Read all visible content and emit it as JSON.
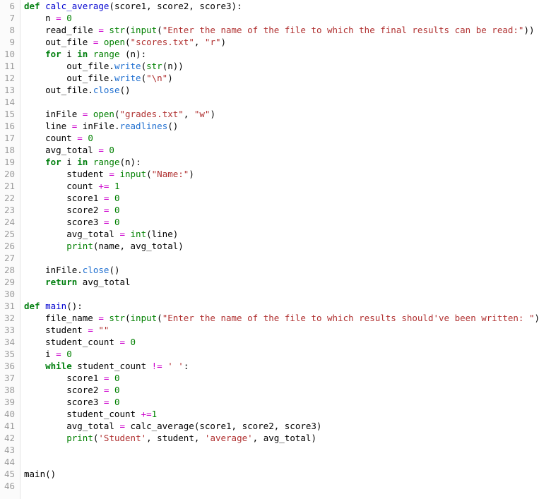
{
  "editor": {
    "language": "Python",
    "first_line_number": 6,
    "last_line_number": 46,
    "colors": {
      "background": "#ffffff",
      "gutter_background": "#fbfbfb",
      "gutter_border": "#e4e4e4",
      "line_number": "#9b9b9b",
      "plain_text": "#000000",
      "keyword": "#007f0e",
      "builtin": "#008000",
      "function_def": "#0000d0",
      "method": "#1f6fd0",
      "string": "#b03030",
      "number": "#008000",
      "operator": "#cc00cc"
    }
  },
  "lines": [
    {
      "n": "6",
      "text": "def calc_average(score1, score2, score3):",
      "tokens": [
        {
          "t": "def",
          "c": "kw"
        },
        {
          "t": " ",
          "c": "pl"
        },
        {
          "t": "calc_average",
          "c": "fn"
        },
        {
          "t": "(score1, score2, score3):",
          "c": "pl"
        }
      ]
    },
    {
      "n": "7",
      "text": "    n = 0",
      "tokens": [
        {
          "t": "    n ",
          "c": "pl"
        },
        {
          "t": "=",
          "c": "op"
        },
        {
          "t": " ",
          "c": "pl"
        },
        {
          "t": "0",
          "c": "num"
        }
      ]
    },
    {
      "n": "8",
      "text": "    read_file = str(input(\"Enter the name of the file to which the final results can be read:\"))",
      "tokens": [
        {
          "t": "    read_file ",
          "c": "pl"
        },
        {
          "t": "=",
          "c": "op"
        },
        {
          "t": " ",
          "c": "pl"
        },
        {
          "t": "str",
          "c": "bi"
        },
        {
          "t": "(",
          "c": "pl"
        },
        {
          "t": "input",
          "c": "bi"
        },
        {
          "t": "(",
          "c": "pl"
        },
        {
          "t": "\"Enter the name of the file to which the final results can be read:\"",
          "c": "str"
        },
        {
          "t": "))",
          "c": "pl"
        }
      ]
    },
    {
      "n": "9",
      "text": "    out_file = open(\"scores.txt\", \"r\")",
      "tokens": [
        {
          "t": "    out_file ",
          "c": "pl"
        },
        {
          "t": "=",
          "c": "op"
        },
        {
          "t": " ",
          "c": "pl"
        },
        {
          "t": "open",
          "c": "bi"
        },
        {
          "t": "(",
          "c": "pl"
        },
        {
          "t": "\"scores.txt\"",
          "c": "str"
        },
        {
          "t": ", ",
          "c": "pl"
        },
        {
          "t": "\"r\"",
          "c": "str"
        },
        {
          "t": ")",
          "c": "pl"
        }
      ]
    },
    {
      "n": "10",
      "text": "    for i in range (n):",
      "tokens": [
        {
          "t": "    ",
          "c": "pl"
        },
        {
          "t": "for",
          "c": "kw"
        },
        {
          "t": " i ",
          "c": "pl"
        },
        {
          "t": "in",
          "c": "kw"
        },
        {
          "t": " ",
          "c": "pl"
        },
        {
          "t": "range",
          "c": "bi"
        },
        {
          "t": " (n):",
          "c": "pl"
        }
      ]
    },
    {
      "n": "11",
      "text": "        out_file.write(str(n))",
      "tokens": [
        {
          "t": "        out_file.",
          "c": "pl"
        },
        {
          "t": "write",
          "c": "mth"
        },
        {
          "t": "(",
          "c": "pl"
        },
        {
          "t": "str",
          "c": "bi"
        },
        {
          "t": "(n))",
          "c": "pl"
        }
      ]
    },
    {
      "n": "12",
      "text": "        out_file.write(\"\\n\")",
      "tokens": [
        {
          "t": "        out_file.",
          "c": "pl"
        },
        {
          "t": "write",
          "c": "mth"
        },
        {
          "t": "(",
          "c": "pl"
        },
        {
          "t": "\"\\n\"",
          "c": "str"
        },
        {
          "t": ")",
          "c": "pl"
        }
      ]
    },
    {
      "n": "13",
      "text": "    out_file.close()",
      "tokens": [
        {
          "t": "    out_file.",
          "c": "pl"
        },
        {
          "t": "close",
          "c": "mth"
        },
        {
          "t": "()",
          "c": "pl"
        }
      ]
    },
    {
      "n": "14",
      "text": "",
      "tokens": []
    },
    {
      "n": "15",
      "text": "    inFile = open(\"grades.txt\", \"w\")",
      "tokens": [
        {
          "t": "    inFile ",
          "c": "pl"
        },
        {
          "t": "=",
          "c": "op"
        },
        {
          "t": " ",
          "c": "pl"
        },
        {
          "t": "open",
          "c": "bi"
        },
        {
          "t": "(",
          "c": "pl"
        },
        {
          "t": "\"grades.txt\"",
          "c": "str"
        },
        {
          "t": ", ",
          "c": "pl"
        },
        {
          "t": "\"w\"",
          "c": "str"
        },
        {
          "t": ")",
          "c": "pl"
        }
      ]
    },
    {
      "n": "16",
      "text": "    line = inFile.readlines()",
      "tokens": [
        {
          "t": "    line ",
          "c": "pl"
        },
        {
          "t": "=",
          "c": "op"
        },
        {
          "t": " inFile.",
          "c": "pl"
        },
        {
          "t": "readlines",
          "c": "mth"
        },
        {
          "t": "()",
          "c": "pl"
        }
      ]
    },
    {
      "n": "17",
      "text": "    count = 0",
      "tokens": [
        {
          "t": "    count ",
          "c": "pl"
        },
        {
          "t": "=",
          "c": "op"
        },
        {
          "t": " ",
          "c": "pl"
        },
        {
          "t": "0",
          "c": "num"
        }
      ]
    },
    {
      "n": "18",
      "text": "    avg_total = 0",
      "tokens": [
        {
          "t": "    avg_total ",
          "c": "pl"
        },
        {
          "t": "=",
          "c": "op"
        },
        {
          "t": " ",
          "c": "pl"
        },
        {
          "t": "0",
          "c": "num"
        }
      ]
    },
    {
      "n": "19",
      "text": "    for i in range(n):",
      "tokens": [
        {
          "t": "    ",
          "c": "pl"
        },
        {
          "t": "for",
          "c": "kw"
        },
        {
          "t": " i ",
          "c": "pl"
        },
        {
          "t": "in",
          "c": "kw"
        },
        {
          "t": " ",
          "c": "pl"
        },
        {
          "t": "range",
          "c": "bi"
        },
        {
          "t": "(n):",
          "c": "pl"
        }
      ]
    },
    {
      "n": "20",
      "text": "        student = input(\"Name:\")",
      "tokens": [
        {
          "t": "        student ",
          "c": "pl"
        },
        {
          "t": "=",
          "c": "op"
        },
        {
          "t": " ",
          "c": "pl"
        },
        {
          "t": "input",
          "c": "bi"
        },
        {
          "t": "(",
          "c": "pl"
        },
        {
          "t": "\"Name:\"",
          "c": "str"
        },
        {
          "t": ")",
          "c": "pl"
        }
      ]
    },
    {
      "n": "21",
      "text": "        count += 1",
      "tokens": [
        {
          "t": "        count ",
          "c": "pl"
        },
        {
          "t": "+=",
          "c": "op"
        },
        {
          "t": " ",
          "c": "pl"
        },
        {
          "t": "1",
          "c": "num"
        }
      ]
    },
    {
      "n": "22",
      "text": "        score1 = 0",
      "tokens": [
        {
          "t": "        score1 ",
          "c": "pl"
        },
        {
          "t": "=",
          "c": "op"
        },
        {
          "t": " ",
          "c": "pl"
        },
        {
          "t": "0",
          "c": "num"
        }
      ]
    },
    {
      "n": "23",
      "text": "        score2 = 0",
      "tokens": [
        {
          "t": "        score2 ",
          "c": "pl"
        },
        {
          "t": "=",
          "c": "op"
        },
        {
          "t": " ",
          "c": "pl"
        },
        {
          "t": "0",
          "c": "num"
        }
      ]
    },
    {
      "n": "24",
      "text": "        score3 = 0",
      "tokens": [
        {
          "t": "        score3 ",
          "c": "pl"
        },
        {
          "t": "=",
          "c": "op"
        },
        {
          "t": " ",
          "c": "pl"
        },
        {
          "t": "0",
          "c": "num"
        }
      ]
    },
    {
      "n": "25",
      "text": "        avg_total = int(line)",
      "tokens": [
        {
          "t": "        avg_total ",
          "c": "pl"
        },
        {
          "t": "=",
          "c": "op"
        },
        {
          "t": " ",
          "c": "pl"
        },
        {
          "t": "int",
          "c": "bi"
        },
        {
          "t": "(line)",
          "c": "pl"
        }
      ]
    },
    {
      "n": "26",
      "text": "        print(name, avg_total)",
      "tokens": [
        {
          "t": "        ",
          "c": "pl"
        },
        {
          "t": "print",
          "c": "bi"
        },
        {
          "t": "(name, avg_total)",
          "c": "pl"
        }
      ]
    },
    {
      "n": "27",
      "text": "",
      "tokens": []
    },
    {
      "n": "28",
      "text": "    inFile.close()",
      "tokens": [
        {
          "t": "    inFile.",
          "c": "pl"
        },
        {
          "t": "close",
          "c": "mth"
        },
        {
          "t": "()",
          "c": "pl"
        }
      ]
    },
    {
      "n": "29",
      "text": "    return avg_total",
      "tokens": [
        {
          "t": "    ",
          "c": "pl"
        },
        {
          "t": "return",
          "c": "kw"
        },
        {
          "t": " avg_total",
          "c": "pl"
        }
      ]
    },
    {
      "n": "30",
      "text": "",
      "tokens": []
    },
    {
      "n": "31",
      "text": "def main():",
      "tokens": [
        {
          "t": "def",
          "c": "kw"
        },
        {
          "t": " ",
          "c": "pl"
        },
        {
          "t": "main",
          "c": "fn"
        },
        {
          "t": "():",
          "c": "pl"
        }
      ]
    },
    {
      "n": "32",
      "text": "    file_name = str(input(\"Enter the name of the file to which results should've been written: \"))",
      "tokens": [
        {
          "t": "    file_name ",
          "c": "pl"
        },
        {
          "t": "=",
          "c": "op"
        },
        {
          "t": " ",
          "c": "pl"
        },
        {
          "t": "str",
          "c": "bi"
        },
        {
          "t": "(",
          "c": "pl"
        },
        {
          "t": "input",
          "c": "bi"
        },
        {
          "t": "(",
          "c": "pl"
        },
        {
          "t": "\"Enter the name of the file to which results should've been written: \"",
          "c": "str"
        },
        {
          "t": "))",
          "c": "pl"
        }
      ]
    },
    {
      "n": "33",
      "text": "    student = \"\"",
      "tokens": [
        {
          "t": "    student ",
          "c": "pl"
        },
        {
          "t": "=",
          "c": "op"
        },
        {
          "t": " ",
          "c": "pl"
        },
        {
          "t": "\"\"",
          "c": "str"
        }
      ]
    },
    {
      "n": "34",
      "text": "    student_count = 0",
      "tokens": [
        {
          "t": "    student_count ",
          "c": "pl"
        },
        {
          "t": "=",
          "c": "op"
        },
        {
          "t": " ",
          "c": "pl"
        },
        {
          "t": "0",
          "c": "num"
        }
      ]
    },
    {
      "n": "35",
      "text": "    i = 0",
      "tokens": [
        {
          "t": "    i ",
          "c": "pl"
        },
        {
          "t": "=",
          "c": "op"
        },
        {
          "t": " ",
          "c": "pl"
        },
        {
          "t": "0",
          "c": "num"
        }
      ]
    },
    {
      "n": "36",
      "text": "    while student_count != ' ':",
      "tokens": [
        {
          "t": "    ",
          "c": "pl"
        },
        {
          "t": "while",
          "c": "kw"
        },
        {
          "t": " student_count ",
          "c": "pl"
        },
        {
          "t": "!=",
          "c": "op"
        },
        {
          "t": " ",
          "c": "pl"
        },
        {
          "t": "' '",
          "c": "str"
        },
        {
          "t": ":",
          "c": "pl"
        }
      ]
    },
    {
      "n": "37",
      "text": "        score1 = 0",
      "tokens": [
        {
          "t": "        score1 ",
          "c": "pl"
        },
        {
          "t": "=",
          "c": "op"
        },
        {
          "t": " ",
          "c": "pl"
        },
        {
          "t": "0",
          "c": "num"
        }
      ]
    },
    {
      "n": "38",
      "text": "        score2 = 0",
      "tokens": [
        {
          "t": "        score2 ",
          "c": "pl"
        },
        {
          "t": "=",
          "c": "op"
        },
        {
          "t": " ",
          "c": "pl"
        },
        {
          "t": "0",
          "c": "num"
        }
      ]
    },
    {
      "n": "39",
      "text": "        score3 = 0",
      "tokens": [
        {
          "t": "        score3 ",
          "c": "pl"
        },
        {
          "t": "=",
          "c": "op"
        },
        {
          "t": " ",
          "c": "pl"
        },
        {
          "t": "0",
          "c": "num"
        }
      ]
    },
    {
      "n": "40",
      "text": "        student_count +=1",
      "tokens": [
        {
          "t": "        student_count ",
          "c": "pl"
        },
        {
          "t": "+=",
          "c": "op"
        },
        {
          "t": "1",
          "c": "num"
        }
      ]
    },
    {
      "n": "41",
      "text": "        avg_total = calc_average(score1, score2, score3)",
      "tokens": [
        {
          "t": "        avg_total ",
          "c": "pl"
        },
        {
          "t": "=",
          "c": "op"
        },
        {
          "t": " calc_average(score1, score2, score3)",
          "c": "pl"
        }
      ]
    },
    {
      "n": "42",
      "text": "        print('Student', student, 'average', avg_total)",
      "tokens": [
        {
          "t": "        ",
          "c": "pl"
        },
        {
          "t": "print",
          "c": "bi"
        },
        {
          "t": "(",
          "c": "pl"
        },
        {
          "t": "'Student'",
          "c": "str"
        },
        {
          "t": ", student, ",
          "c": "pl"
        },
        {
          "t": "'average'",
          "c": "str"
        },
        {
          "t": ", avg_total)",
          "c": "pl"
        }
      ]
    },
    {
      "n": "43",
      "text": "",
      "tokens": []
    },
    {
      "n": "44",
      "text": "",
      "tokens": []
    },
    {
      "n": "45",
      "text": "main()",
      "tokens": [
        {
          "t": "main()",
          "c": "pl"
        }
      ]
    },
    {
      "n": "46",
      "text": "",
      "tokens": []
    }
  ]
}
